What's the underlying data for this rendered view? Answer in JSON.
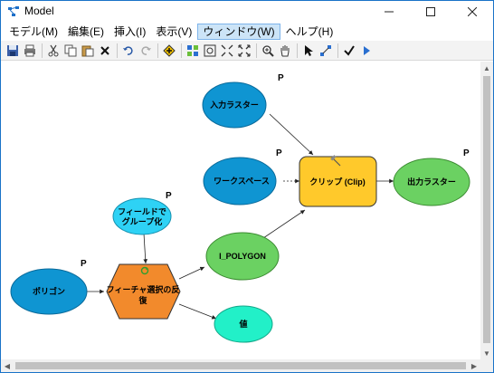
{
  "window": {
    "title": "Model"
  },
  "menu": [
    {
      "label": "モデル(M)",
      "active": false
    },
    {
      "label": "編集(E)",
      "active": false
    },
    {
      "label": "挿入(I)",
      "active": false
    },
    {
      "label": "表示(V)",
      "active": false
    },
    {
      "label": "ウィンドウ(W)",
      "active": true
    },
    {
      "label": "ヘルプ(H)",
      "active": false
    }
  ],
  "toolbar": [
    "save-icon",
    "print-icon",
    "cut-icon",
    "copy-icon",
    "paste-icon",
    "delete-icon",
    "undo-icon",
    "redo-icon",
    "add-data-icon",
    "auto-layout-icon",
    "full-extent-icon",
    "zoom-in-fixed-icon",
    "zoom-out-fixed-icon",
    "zoom-in-icon",
    "pan-icon",
    "select-icon",
    "connect-icon",
    "validate-icon",
    "run-icon"
  ],
  "model": {
    "nodes": {
      "input_raster": {
        "label": "入力ラスター",
        "param": "P",
        "color": "#0f95d2"
      },
      "workspace": {
        "label": "ワークスペース",
        "param": "P",
        "color": "#0f95d2"
      },
      "clip_tool": {
        "label": "クリップ (Clip)",
        "color": "#ffc92b"
      },
      "output_raster": {
        "label": "出力ラスター",
        "param": "P",
        "color": "#6bd162"
      },
      "group_field": {
        "label_line1": "フィールドで",
        "label_line2": "グループ化",
        "param": "P",
        "color": "#2ed2f5"
      },
      "polygon": {
        "label": "ポリゴン",
        "param": "P",
        "color": "#0f95d2"
      },
      "iterator": {
        "label_line1": "フィーチャ選択の反",
        "label_line2": "復",
        "color": "#f28a2c"
      },
      "i_polygon": {
        "label": "I_POLYGON",
        "color": "#6bd162"
      },
      "value": {
        "label": "値",
        "color": "#22f0c8"
      }
    }
  }
}
